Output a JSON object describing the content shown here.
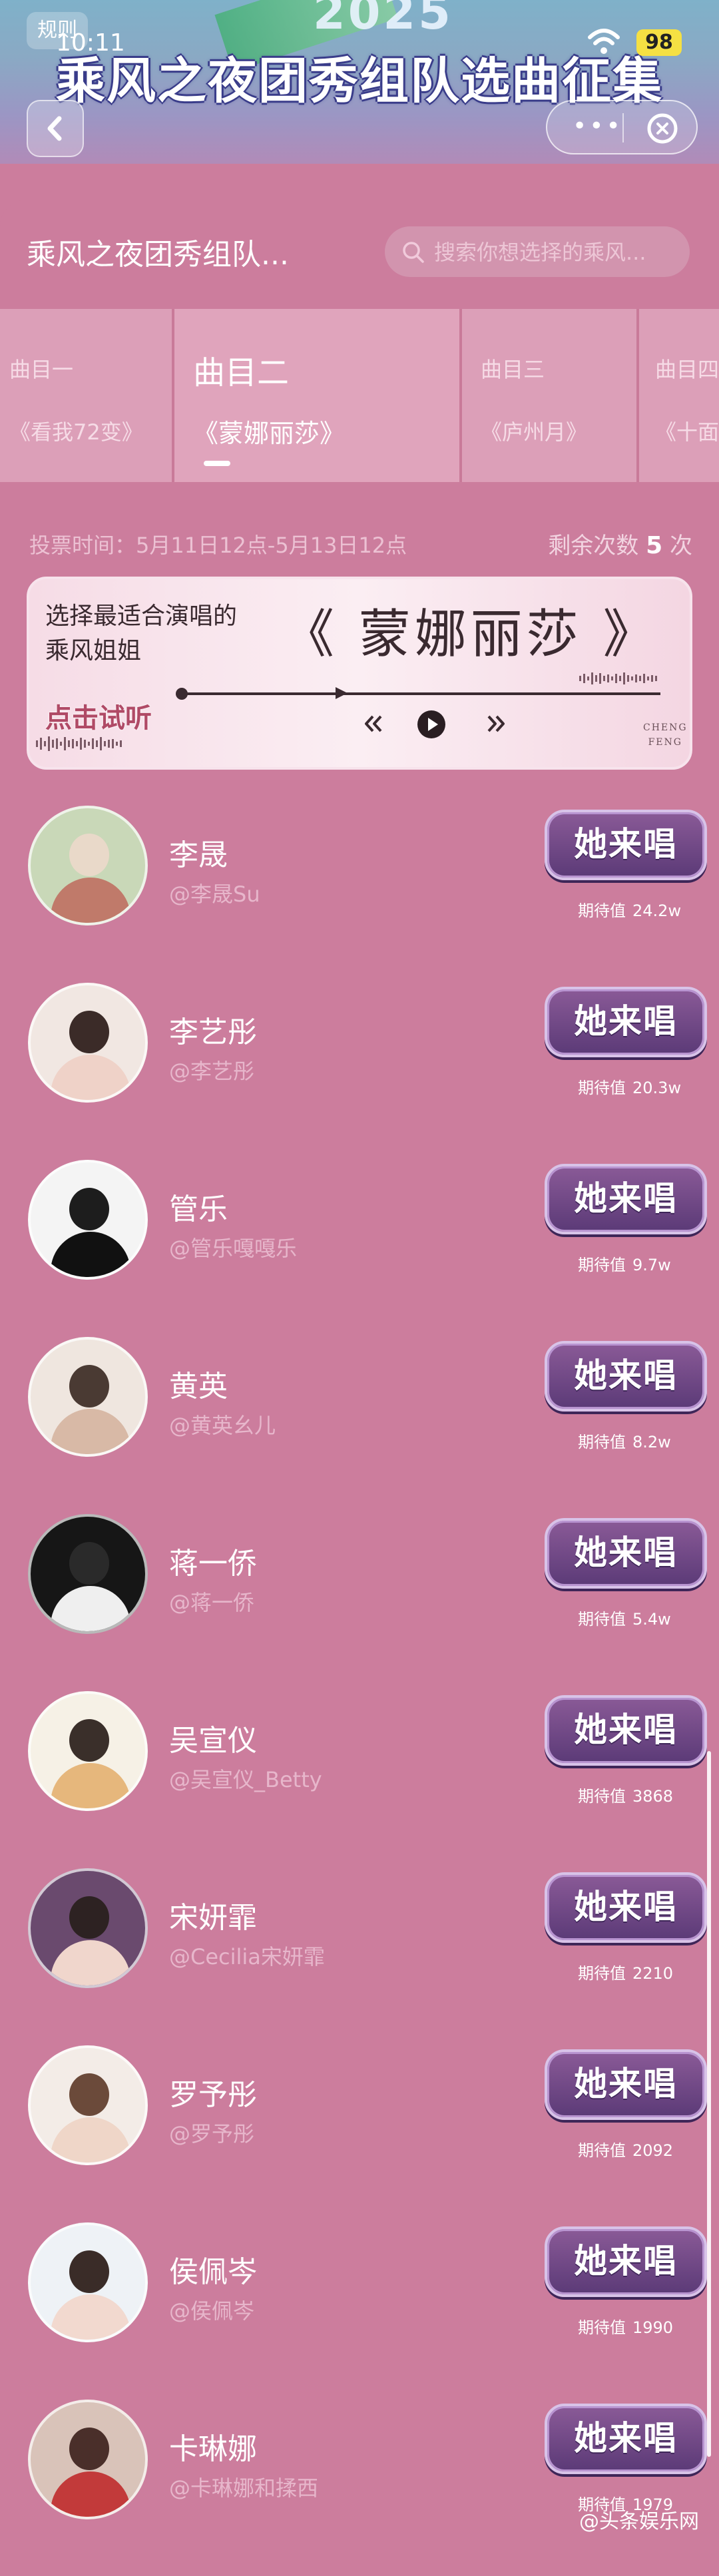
{
  "header": {
    "year": "2025",
    "title": "乘风之夜团秀组队选曲征集",
    "rules_label": "规则",
    "status_time": "10:11",
    "battery": "98"
  },
  "main": {
    "activity_name": "乘风之夜团秀组队...",
    "search_placeholder": "搜索你想选择的乘风..."
  },
  "songs": [
    {
      "num": "曲目一",
      "name": "《看我72变》"
    },
    {
      "num": "曲目二",
      "name": "《蒙娜丽莎》"
    },
    {
      "num": "曲目三",
      "name": "《庐州月》"
    },
    {
      "num": "曲目四",
      "name": "《十面"
    }
  ],
  "vote": {
    "time": "投票时间：5月11日12点-5月13日12点",
    "remain_label": "剩余次数",
    "remain_count": "5",
    "remain_unit": "次"
  },
  "player": {
    "prompt_line1": "选择最适合演唱的",
    "prompt_line2": "乘风姐姐",
    "song_title": "《 蒙娜丽莎 》",
    "listen_label": "点击试听",
    "brand_line1": "CHENG",
    "brand_line2": "FENG"
  },
  "vote_button_label": "她来唱",
  "expect_label": "期待值",
  "candidates": [
    {
      "name": "李晟",
      "handle": "@李晟Su",
      "expect": "24.2w"
    },
    {
      "name": "李艺彤",
      "handle": "@李艺彤",
      "expect": "20.3w"
    },
    {
      "name": "管乐",
      "handle": "@管乐嘎嘎乐",
      "expect": "9.7w"
    },
    {
      "name": "黄英",
      "handle": "@黄英幺儿",
      "expect": "8.2w"
    },
    {
      "name": "蒋一侨",
      "handle": "@蒋一侨",
      "expect": "5.4w"
    },
    {
      "name": "吴宣仪",
      "handle": "@吴宣仪_Betty",
      "expect": "3868"
    },
    {
      "name": "宋妍霏",
      "handle": "@Cecilia宋妍霏",
      "expect": "2210"
    },
    {
      "name": "罗予彤",
      "handle": "@罗予彤",
      "expect": "2092"
    },
    {
      "name": "侯佩岑",
      "handle": "@侯佩岑",
      "expect": "1990"
    },
    {
      "name": "卡琳娜",
      "handle": "@卡琳娜和揉西",
      "expect": "1979"
    }
  ],
  "avatar_colors": [
    {
      "bg": "#c9d8b8",
      "head": "#e9d9c9",
      "body": "#c07a6a"
    },
    {
      "bg": "#f1e7e2",
      "head": "#3b2b28",
      "body": "#efd2c8"
    },
    {
      "bg": "#f4f4f4",
      "head": "#1d1d1d",
      "body": "#111111"
    },
    {
      "bg": "#efe6df",
      "head": "#4a3a33",
      "body": "#d8b9a6"
    },
    {
      "bg": "#161616",
      "head": "#2a2a2a",
      "body": "#efefef"
    },
    {
      "bg": "#f6f1e6",
      "head": "#3a2f2a",
      "body": "#e6b77c"
    },
    {
      "bg": "#6a4a6e",
      "head": "#2d2222",
      "body": "#f0d6cc"
    },
    {
      "bg": "#f3ece7",
      "head": "#6b4a3a",
      "body": "#efd6c8"
    },
    {
      "bg": "#eef2f6",
      "head": "#3a2c28",
      "body": "#f2d9cf"
    },
    {
      "bg": "#d9c3b9",
      "head": "#4a2f2a",
      "body": "#c23a3a"
    }
  ],
  "watermark": "@头条娱乐网"
}
